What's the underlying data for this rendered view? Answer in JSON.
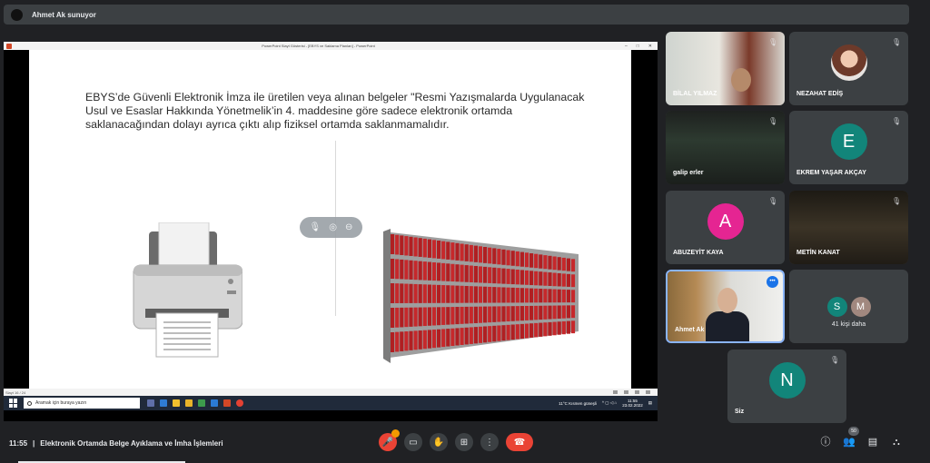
{
  "presenter_bar": {
    "text": "Ahmet Ak sunuyor"
  },
  "screen": {
    "window_title": "PowerPoint Slayt Gösterisi - [EBYS ve Saklama Planları] - PowerPoint",
    "slide_text": "EBYS’de Güvenli Elektronik İmza ile üretilen veya alınan belgeler \"Resmi Yazışmalarda Uygulanacak Usul ve Esaslar Hakkında Yönetmelik’in 4. maddesine göre sadece elektronik ortamda saklanacağından dolayı ayrıca çıktı alıp fiziksel ortamda saklanmamalıdır.",
    "status_left": "Slayt 16 / 24",
    "taskbar": {
      "search_placeholder": "Aramak için buraya yazın",
      "weather": "11°C  Kısmen güneşli",
      "clock_time": "11:55",
      "clock_date": "23.02.2022"
    }
  },
  "participants": [
    {
      "name": "BİLAL YILMAZ",
      "type": "video",
      "muted": true
    },
    {
      "name": "NEZAHAT EDİŞ",
      "type": "photo",
      "muted": true
    },
    {
      "name": "galip erler",
      "type": "video",
      "muted": true
    },
    {
      "name": "EKREM YAŞAR AKÇAY",
      "type": "avatar",
      "initial": "E",
      "color": "#12857a",
      "muted": true
    },
    {
      "name": "ABUZEYİT KAYA",
      "type": "avatar",
      "initial": "A",
      "color": "#e52592",
      "muted": true
    },
    {
      "name": "METİN KANAT",
      "type": "video",
      "muted": true
    },
    {
      "name": "Ahmet Ak",
      "type": "video",
      "muted": false
    },
    {
      "name": "41 kişi daha",
      "type": "more",
      "initials": [
        "S",
        "M"
      ],
      "colors": [
        "#12857a",
        "#a1887f"
      ]
    },
    {
      "name": "Siz",
      "type": "avatar",
      "initial": "N",
      "color": "#12857a",
      "muted": true
    }
  ],
  "bottom_bar": {
    "time": "11:55",
    "separator": "|",
    "meeting_title": "Elektronik Ortamda Belge Ayıklama ve İmha İşlemleri",
    "people_count": "50"
  }
}
